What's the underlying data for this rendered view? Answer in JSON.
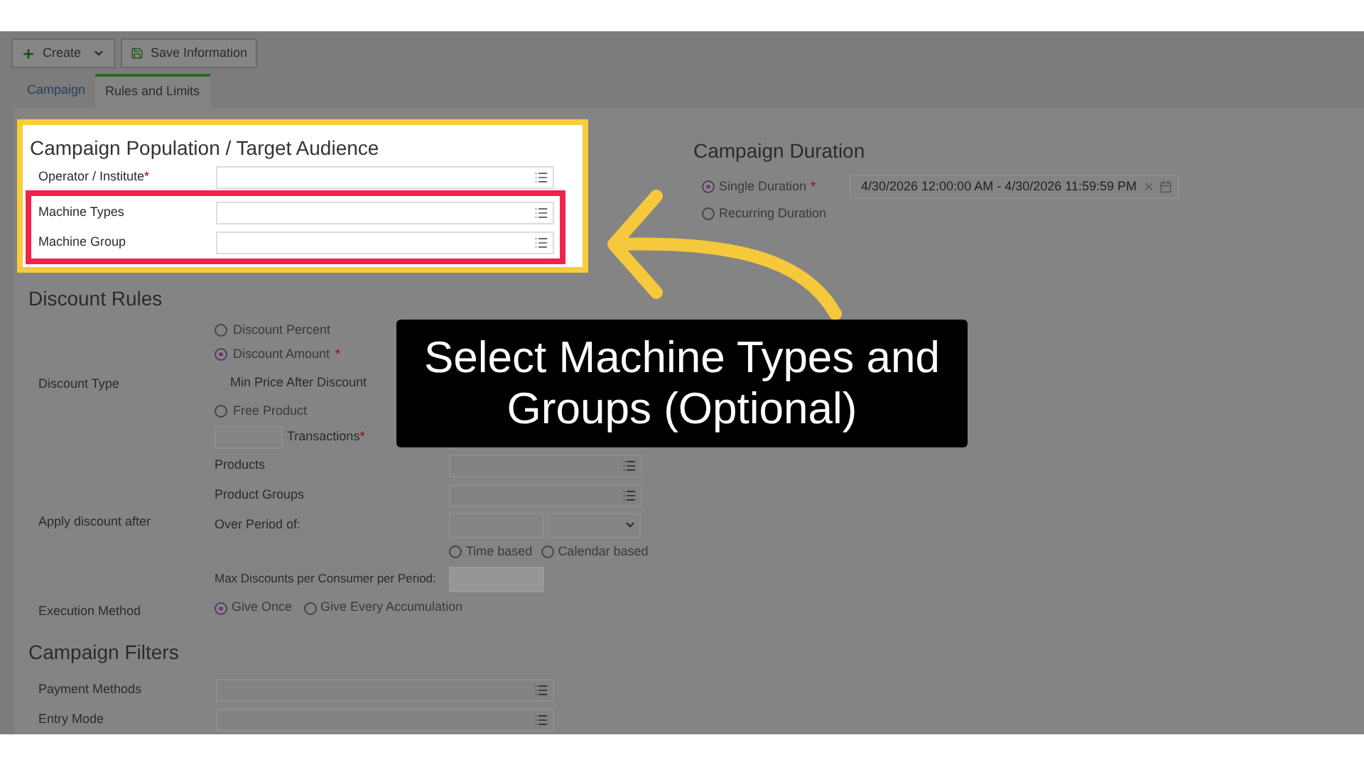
{
  "toolbar": {
    "buttons": [
      {
        "label": "Create",
        "kind": "dropdown"
      },
      {
        "label": "Save Information",
        "kind": "save"
      }
    ]
  },
  "tabs": [
    {
      "label": "Campaign",
      "selected": false
    },
    {
      "label": "Rules and Limits",
      "selected": true
    }
  ],
  "population": {
    "title": "Campaign Population / Target Audience",
    "fields": [
      {
        "label": "Operator / Institute",
        "mark": "*"
      }
    ],
    "marked_fields": [
      {
        "label": "Machine Types"
      },
      {
        "label": "Machine Group"
      }
    ]
  },
  "duration": {
    "title": "Campaign Duration",
    "options": [
      {
        "label": "Single Duration",
        "mark": "*",
        "selected": true,
        "value": "4/30/2026 12:00:00 AM - 4/30/2026 11:59:59 PM"
      },
      {
        "label": "Recurring Duration",
        "selected": false
      }
    ]
  },
  "discount_rules": {
    "title": "Discount Rules",
    "type_label": "Discount Type",
    "type_options": [
      {
        "label": "Discount Percent",
        "selected": false
      },
      {
        "label": "Discount Amount",
        "mark": "*",
        "selected": true
      }
    ],
    "min_price_label": "Min Price After Discount",
    "free_option": {
      "label": "Free Product",
      "selected": false
    },
    "transactions": {
      "label": "Transactions",
      "mark": "*"
    },
    "apply_label": "Apply discount after",
    "products_label": "Products",
    "product_groups_label": "Product Groups",
    "period_label": "Over Period of:",
    "period_options": [
      {
        "label": "Time based",
        "selected": false
      },
      {
        "label": "Calendar based",
        "selected": false
      }
    ],
    "max_label": "Max Discounts per Consumer per Period:",
    "execution_label": "Execution Method",
    "execution_options": [
      {
        "label": "Give Once",
        "selected": true
      },
      {
        "label": "Give Every Accumulation",
        "selected": false
      }
    ]
  },
  "filters": {
    "title": "Campaign Filters",
    "fields": [
      {
        "label": "Payment Methods"
      },
      {
        "label": "Entry Mode"
      }
    ]
  },
  "callout": {
    "text": "Select Machine Types and Groups (Optional)"
  }
}
